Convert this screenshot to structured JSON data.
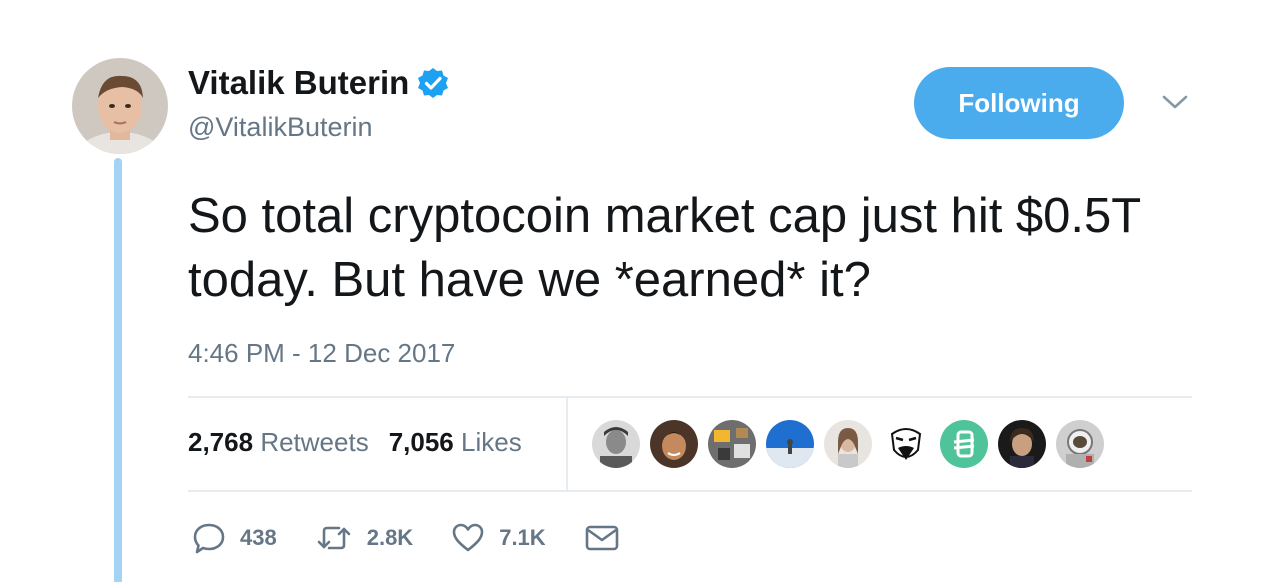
{
  "author": {
    "display_name": "Vitalik Buterin",
    "handle": "@VitalikButerin",
    "verified": true
  },
  "follow_button": {
    "label": "Following"
  },
  "tweet": {
    "text": "So total cryptocoin market cap just hit $0.5T today. But have we *earned* it?",
    "timestamp": "4:46 PM - 12 Dec 2017"
  },
  "stats": {
    "retweets_count": "2,768",
    "retweets_label": "Retweets",
    "likes_count": "7,056",
    "likes_label": "Likes"
  },
  "actions": {
    "replies": "438",
    "retweets": "2.8K",
    "likes": "7.1K"
  },
  "icons": {
    "verified": "verified-badge-icon",
    "caret": "chevron-down-icon",
    "reply": "reply-icon",
    "retweet": "retweet-icon",
    "like": "heart-icon",
    "message": "envelope-icon"
  },
  "colors": {
    "accent": "#4aabed",
    "thread_line": "#a3d4f5",
    "secondary_text": "#657786",
    "primary_text": "#14171a",
    "divider": "#e6ecf0"
  }
}
